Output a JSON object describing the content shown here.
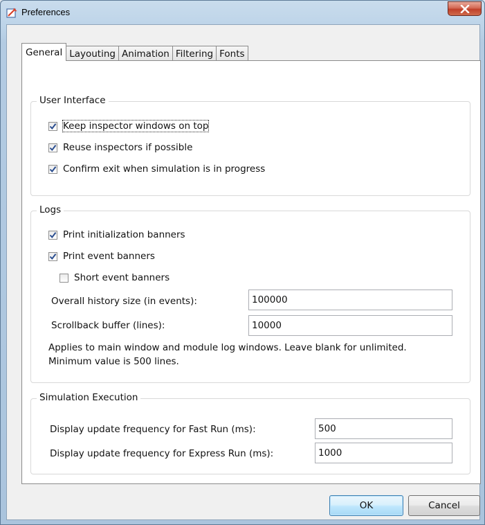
{
  "window": {
    "title": "Preferences",
    "icons": {
      "app": "preferences-app-icon",
      "close": "close-icon"
    }
  },
  "tabs": [
    {
      "label": "General",
      "active": true
    },
    {
      "label": "Layouting",
      "active": false
    },
    {
      "label": "Animation",
      "active": false
    },
    {
      "label": "Filtering",
      "active": false
    },
    {
      "label": "Fonts",
      "active": false
    }
  ],
  "user_interface": {
    "title": "User Interface",
    "keep_on_top": {
      "label": "Keep inspector windows on top",
      "checked": true
    },
    "reuse_inspectors": {
      "label": "Reuse inspectors if possible",
      "checked": true
    },
    "confirm_exit": {
      "label": "Confirm exit when simulation is in progress",
      "checked": true
    }
  },
  "logs": {
    "title": "Logs",
    "print_init_banners": {
      "label": "Print initialization banners",
      "checked": true
    },
    "print_event_banners": {
      "label": "Print event banners",
      "checked": true
    },
    "short_event_banners": {
      "label": "Short event banners",
      "checked": false
    },
    "history_size": {
      "label": "Overall history size (in events):",
      "value": "100000"
    },
    "scrollback": {
      "label": "Scrollback buffer (lines):",
      "value": "10000"
    },
    "note": "Applies to main window and module log windows. Leave blank for unlimited. Minimum value is 500 lines."
  },
  "simulation_execution": {
    "title": "Simulation Execution",
    "fast_run": {
      "label": "Display update frequency for Fast Run (ms):",
      "value": "500"
    },
    "express_run": {
      "label": "Display update frequency for Express Run (ms):",
      "value": "1000"
    }
  },
  "buttons": {
    "ok": "OK",
    "cancel": "Cancel"
  },
  "colors": {
    "checkmark": "#2a4d8f",
    "default_button_border": "#3c7fb1",
    "close_button": "#c0402a"
  }
}
